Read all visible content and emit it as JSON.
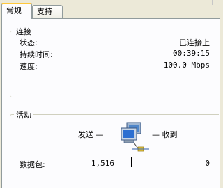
{
  "tabs": [
    {
      "label": "常规",
      "active": true
    },
    {
      "label": "支持",
      "active": false
    }
  ],
  "connection": {
    "legend": "连接",
    "rows": [
      {
        "label": "状态:",
        "value": "已连接上"
      },
      {
        "label": "持续时间:",
        "value": "00:39:15"
      },
      {
        "label": "速度:",
        "value": "100.0 Mbps"
      }
    ]
  },
  "activity": {
    "legend": "活动",
    "sent_label": "发送 —",
    "received_label": "— 收到",
    "packets_label": "数据包:",
    "sent_value": "1,516",
    "received_value": "0",
    "icon": "network-computers-icon"
  },
  "colors": {
    "window_bg": "#ece9d8",
    "panel_bg": "#fcfcfe",
    "tab_highlight": "#ffc83c",
    "border": "#919b9c"
  }
}
